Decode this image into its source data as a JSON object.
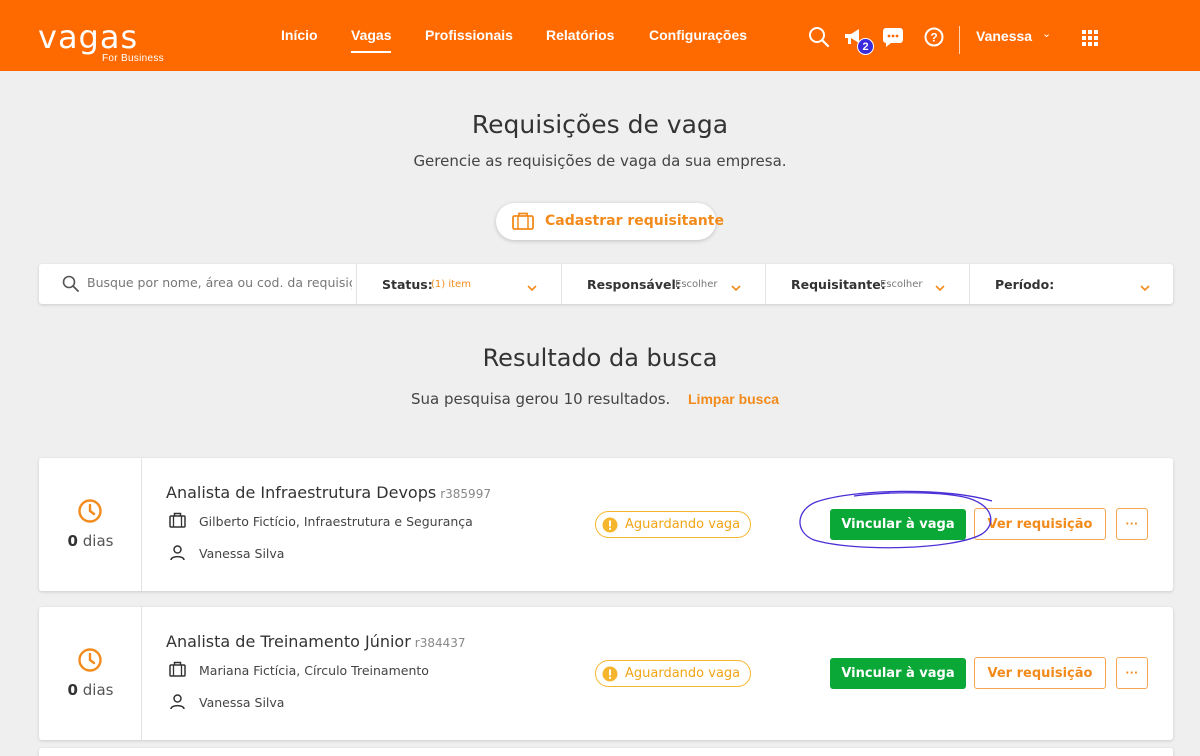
{
  "header": {
    "logo_main": "vagas",
    "logo_sub": "For Business",
    "nav": [
      "Início",
      "Vagas",
      "Profissionais",
      "Relatórios",
      "Configurações"
    ],
    "active_nav": "Vagas",
    "notification_count": "2",
    "user_name": "Vanessa",
    "brand_color": "#ff6a00"
  },
  "page": {
    "title": "Requisições de vaga",
    "subtitle": "Gerencie as requisições de vaga da sua empresa.",
    "register_button": "Cadastrar requisitante"
  },
  "filters": {
    "search_placeholder": "Busque por nome, área ou cod. da requisição",
    "status": {
      "label": "Status:",
      "value": "(1) item"
    },
    "responsavel": {
      "label": "Responsável:",
      "value": "Escolher"
    },
    "requisitante": {
      "label": "Requisitante:",
      "value": "Escolher"
    },
    "periodo": {
      "label": "Período:",
      "value": ""
    }
  },
  "results": {
    "title": "Resultado da busca",
    "count_text": "Sua pesquisa gerou 10 resultados.",
    "clear_link": "Limpar busca"
  },
  "cards": [
    {
      "days_num": "0",
      "days_unit": "dias",
      "title": "Analista de Infraestrutura Devops",
      "code": "r385997",
      "company": "Gilberto Fictício, Infraestrutura e Segurança",
      "owner": "Vanessa Silva",
      "status": "Aguardando vaga",
      "primary_action": "Vincular à vaga",
      "secondary_action": "Ver requisição",
      "more": "···"
    },
    {
      "days_num": "0",
      "days_unit": "dias",
      "title": "Analista de Treinamento Júnior",
      "code": "r384437",
      "company": "Mariana Fictícia, Círculo Treinamento",
      "owner": "Vanessa Silva",
      "status": "Aguardando vaga",
      "primary_action": "Vincular à vaga",
      "secondary_action": "Ver requisição",
      "more": "···"
    }
  ]
}
